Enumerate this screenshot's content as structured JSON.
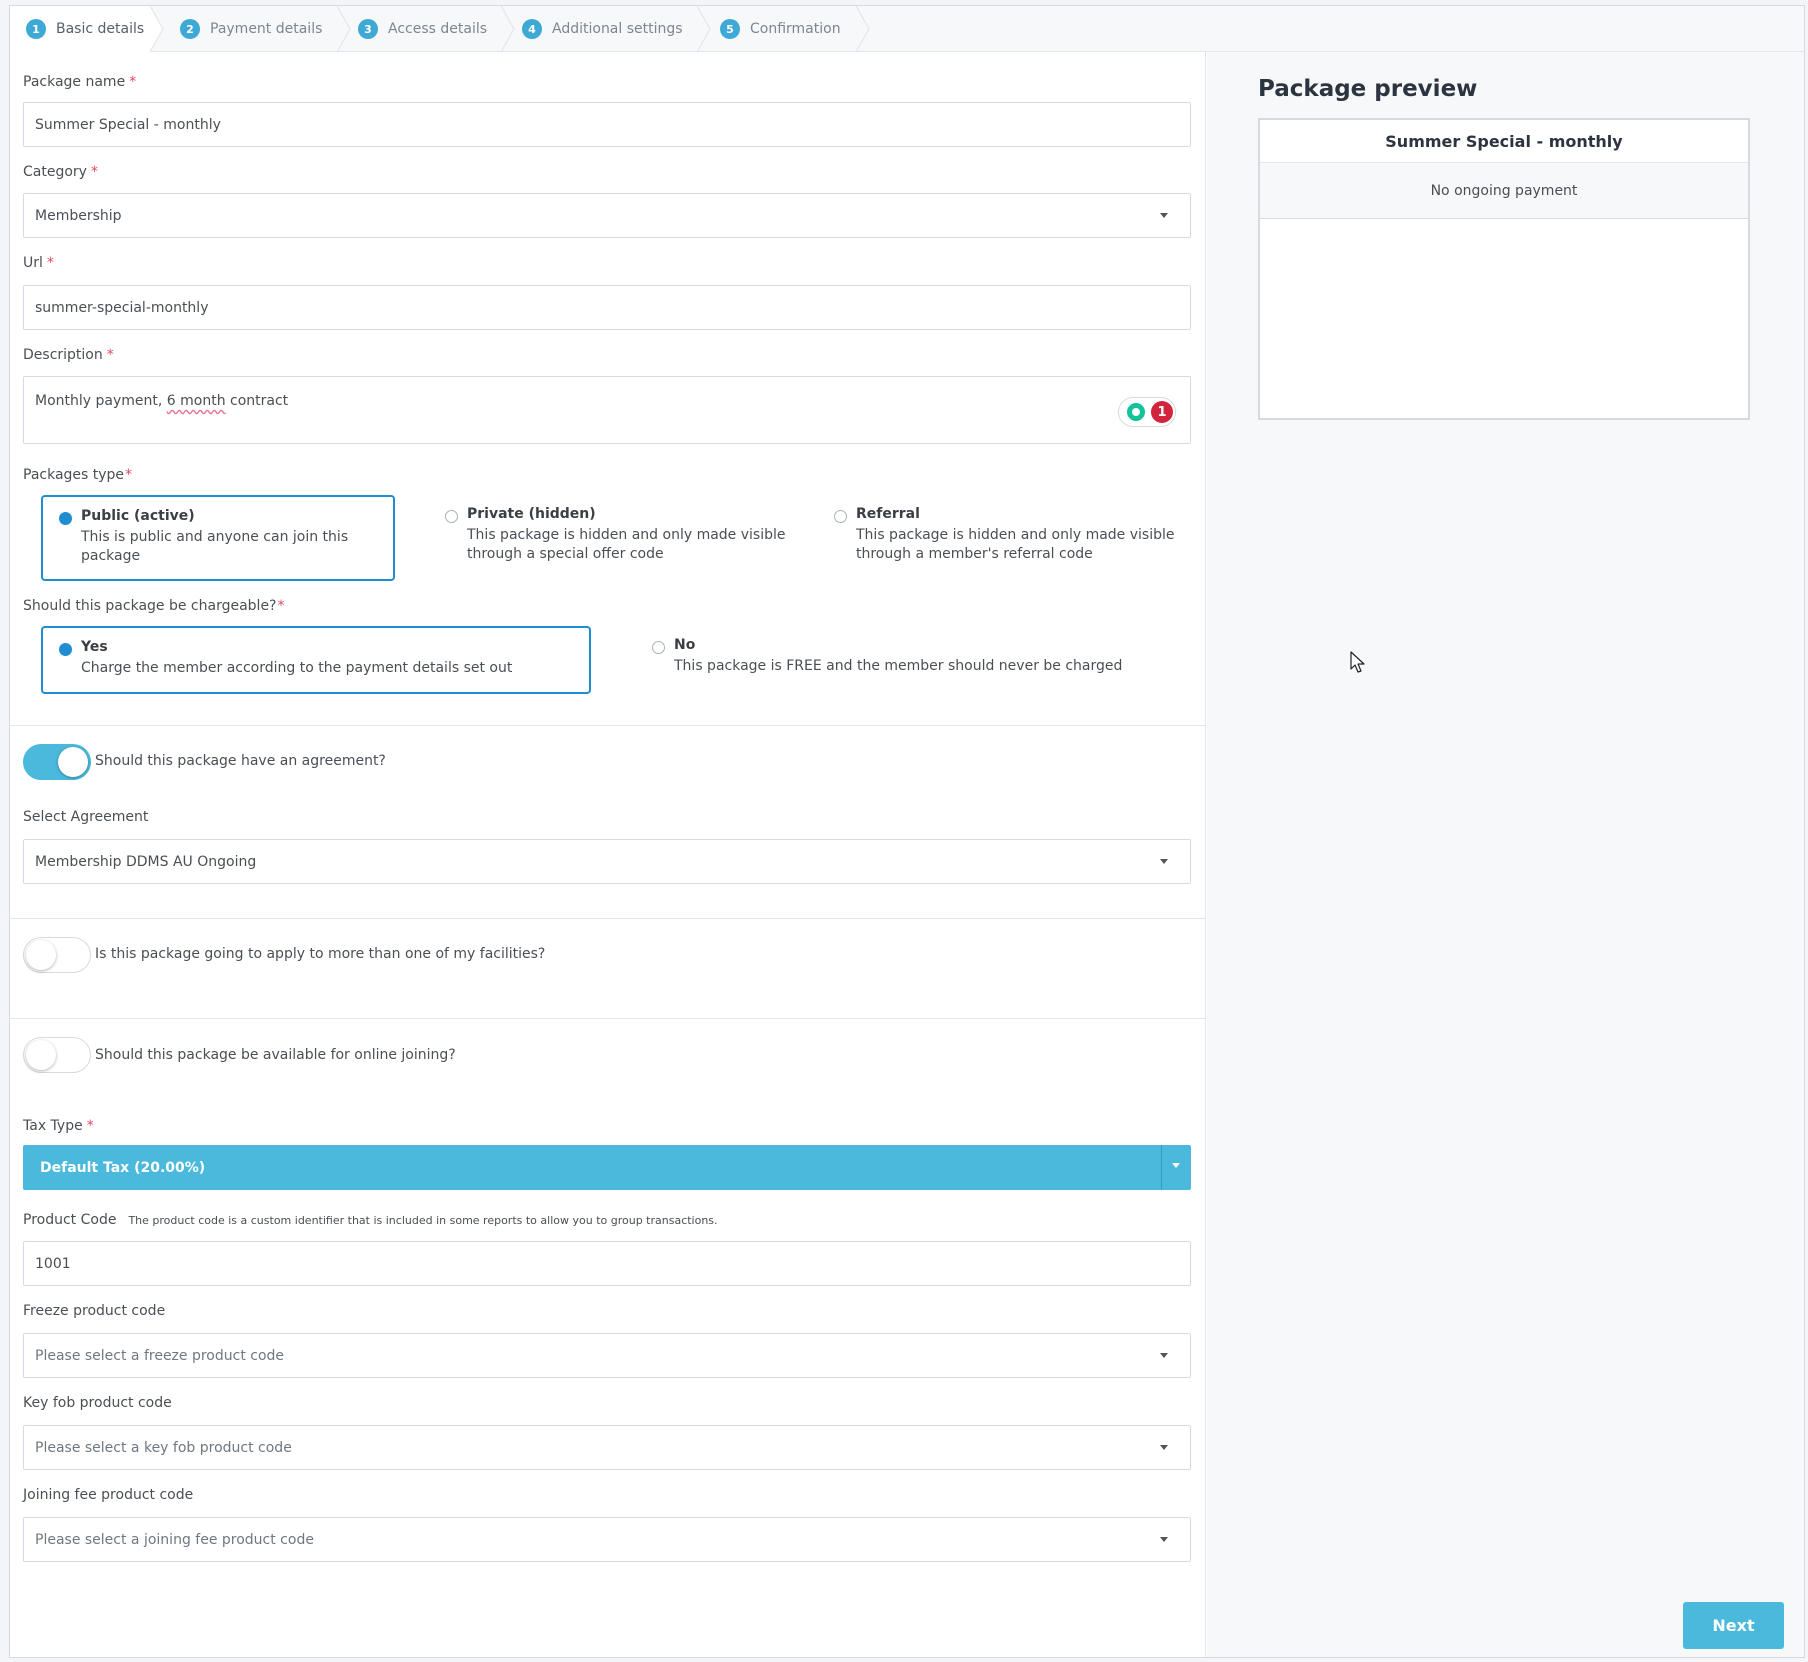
{
  "wizard": {
    "steps": [
      {
        "num": "1",
        "label": "Basic details"
      },
      {
        "num": "2",
        "label": "Payment details"
      },
      {
        "num": "3",
        "label": "Access details"
      },
      {
        "num": "4",
        "label": "Additional settings"
      },
      {
        "num": "5",
        "label": "Confirmation"
      }
    ],
    "active_step": "Basic details"
  },
  "form": {
    "package_name": {
      "label": "Package name",
      "required": "*",
      "value": "Summer Special - monthly"
    },
    "category": {
      "label": "Category",
      "required": "*",
      "value": "Membership"
    },
    "url": {
      "label": "Url",
      "required": "*",
      "value": "summer-special-monthly"
    },
    "description": {
      "label": "Description",
      "required": "*",
      "value_before": "Monthly payment, ",
      "value_flagged": "6 month",
      "value_after": " contract",
      "grammar_badge": "1"
    },
    "packages_type": {
      "label": "Packages type",
      "required": "*",
      "options": [
        {
          "title": "Public (active)",
          "desc1": "This is public and anyone can join this",
          "desc2": "package",
          "selected": true
        },
        {
          "title": "Private (hidden)",
          "desc1": "This package is hidden and only made visible",
          "desc2": "through a special offer code",
          "selected": false
        },
        {
          "title": "Referral",
          "desc1": "This package is hidden and only made visible",
          "desc2": "through a member's referral code",
          "selected": false
        }
      ]
    },
    "chargeable": {
      "label": "Should this package be chargeable?",
      "required": "*",
      "options": [
        {
          "title": "Yes",
          "desc": "Charge the member according to the payment details set out",
          "selected": true
        },
        {
          "title": "No",
          "desc": "This package is FREE and the member should never be charged",
          "selected": false
        }
      ]
    },
    "agreement_toggle": {
      "label": "Should this package have an agreement?",
      "on": true
    },
    "select_agreement": {
      "label": "Select Agreement",
      "value": "Membership DDMS AU Ongoing"
    },
    "multi_facility_toggle": {
      "label": "Is this package going to apply to more than one of my facilities?",
      "on": false
    },
    "online_joining_toggle": {
      "label": "Should this package be available for online joining?",
      "on": false
    },
    "tax_type": {
      "label": "Tax Type",
      "required": "*",
      "value": "Default Tax (20.00%)"
    },
    "product_code": {
      "label": "Product Code",
      "hint": "The product code is a custom identifier that is included in some reports to allow you to group transactions.",
      "value": "1001"
    },
    "freeze_product_code": {
      "label": "Freeze product code",
      "placeholder": "Please select a freeze product code"
    },
    "key_fob_product_code": {
      "label": "Key fob product code",
      "placeholder": "Please select a key fob product code"
    },
    "joining_fee_product_code": {
      "label": "Joining fee product code",
      "placeholder": "Please select a joining fee product code"
    }
  },
  "preview": {
    "title": "Package preview",
    "card_title": "Summer Special - monthly",
    "card_subtitle": "No ongoing payment"
  },
  "actions": {
    "next_label": "Next"
  },
  "colors": {
    "accent": "#4bb9dc",
    "selected_border": "#1f8ed1",
    "required": "#e2485f",
    "step_badge": "#3fa9d6"
  }
}
